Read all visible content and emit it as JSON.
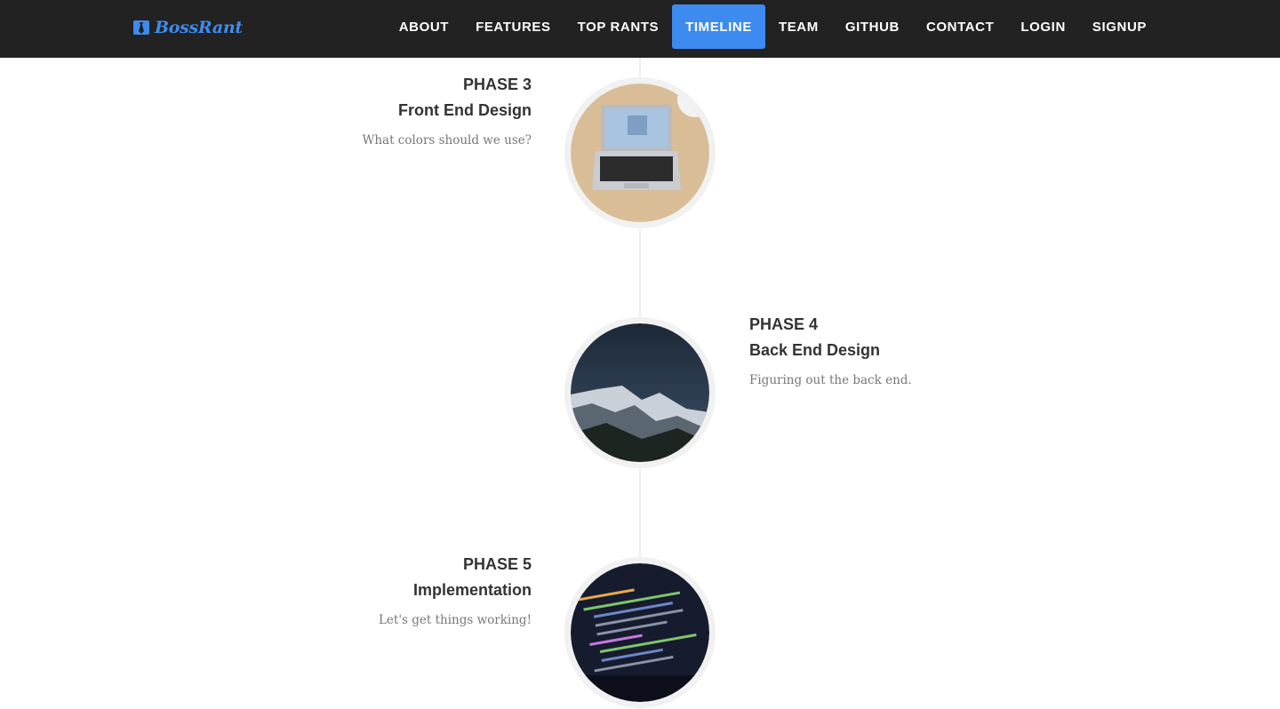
{
  "brand": {
    "name": "BossRant",
    "icon": "tie-icon",
    "color": "#3d8bf0"
  },
  "nav": {
    "items": [
      {
        "label": "ABOUT",
        "active": false
      },
      {
        "label": "FEATURES",
        "active": false
      },
      {
        "label": "TOP RANTS",
        "active": false
      },
      {
        "label": "TIMELINE",
        "active": true
      },
      {
        "label": "TEAM",
        "active": false
      },
      {
        "label": "GITHUB",
        "active": false
      },
      {
        "label": "CONTACT",
        "active": false
      },
      {
        "label": "LOGIN",
        "active": false
      },
      {
        "label": "SIGNUP",
        "active": false
      }
    ],
    "active_color": "#3d8bf0",
    "background": "#222222"
  },
  "timeline": {
    "items": [
      {
        "phase": "PHASE 3",
        "title": "Front End Design",
        "description": "What colors should we use?",
        "image": "laptop-on-desk-photo"
      },
      {
        "phase": "PHASE 4",
        "title": "Back End Design",
        "description": "Figuring out the back end.",
        "image": "snowy-mountain-night-photo"
      },
      {
        "phase": "PHASE 5",
        "title": "Implementation",
        "description": "Let's get things working!",
        "image": "code-on-screen-photo"
      }
    ]
  }
}
